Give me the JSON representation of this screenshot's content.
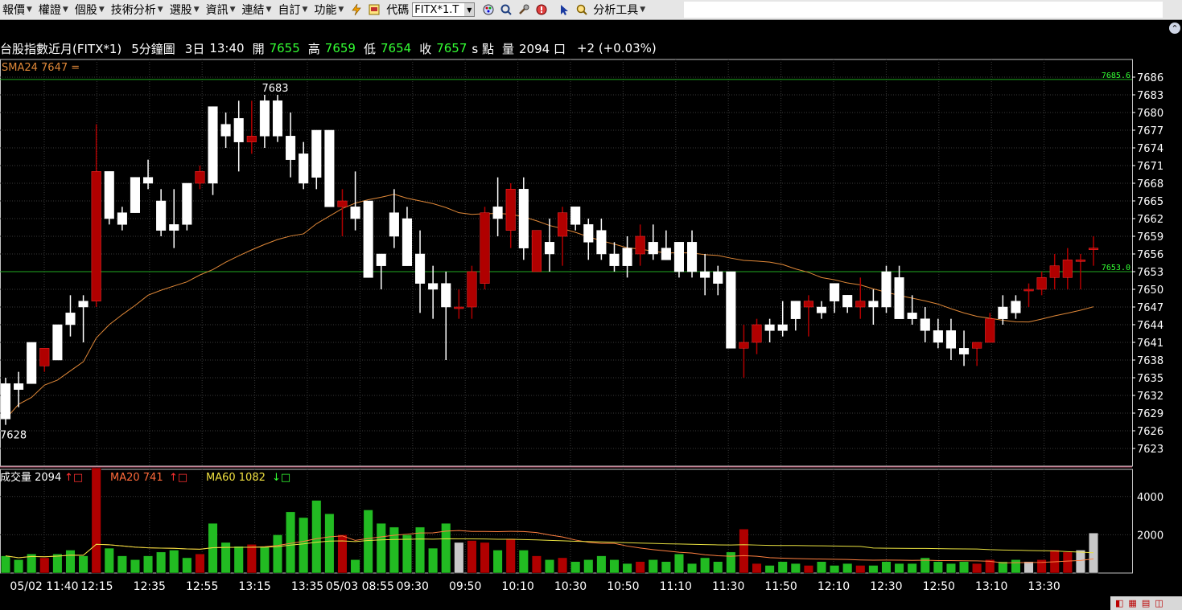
{
  "menu": {
    "items": [
      {
        "label": "報價",
        "name": "menu-quote"
      },
      {
        "label": "權證",
        "name": "menu-warrant"
      },
      {
        "label": "個股",
        "name": "menu-stock"
      },
      {
        "label": "技術分析",
        "name": "menu-technical"
      },
      {
        "label": "選股",
        "name": "menu-screener"
      },
      {
        "label": "資訊",
        "name": "menu-info"
      },
      {
        "label": "連結",
        "name": "menu-links"
      },
      {
        "label": "自訂",
        "name": "menu-custom"
      },
      {
        "label": "功能",
        "name": "menu-functions"
      }
    ],
    "code_label": "代碼",
    "code_value": "FITX*1.T",
    "tools_label": "分析工具"
  },
  "info": {
    "name": "台股指數近月(FITX*1)",
    "period": "5分鐘圖",
    "date": "3日",
    "time": "13:40",
    "open_label": "開",
    "open": "7655",
    "high_label": "高",
    "high": "7659",
    "low_label": "低",
    "low": "7654",
    "close_label": "收",
    "close": "7657",
    "unit": "s 點",
    "volume_label": "量",
    "volume": "2094 口",
    "change": "+2 (+0.03%)"
  },
  "indicators": {
    "sma_label": "SMA24 7647 =",
    "vol_label": "成交量 2094",
    "vol_ma20": "MA20 741",
    "vol_ma60": "MA60 1082"
  },
  "chart_data": {
    "type": "candlestick",
    "price_axis": {
      "min": 7620,
      "max": 7689,
      "ticks": [
        7686,
        7683,
        7680,
        7677,
        7674,
        7671,
        7668,
        7665,
        7662,
        7659,
        7656,
        7653,
        7650,
        7647,
        7644,
        7641,
        7638,
        7635,
        7632,
        7629,
        7626,
        7623
      ]
    },
    "volume_axis": {
      "max": 5000,
      "ticks": [
        4000,
        2000
      ]
    },
    "time_labels": [
      "05/02 11:40",
      "12:15",
      "12:35",
      "12:55",
      "13:15",
      "13:35",
      "05/03 08:55",
      "09:30",
      "09:50",
      "10:10",
      "10:30",
      "10:50",
      "11:10",
      "11:30",
      "11:50",
      "12:10",
      "12:30",
      "12:50",
      "13:10",
      "13:30"
    ],
    "annotations": {
      "high_label": "7683",
      "low_label": "7628",
      "right_top": "7685.6",
      "right_mid": "7653.0"
    },
    "hlines": [
      7685.6,
      7653.0
    ],
    "candles": [
      [
        7634,
        7635,
        7627,
        7628,
        900
      ],
      [
        7634,
        7636,
        7630,
        7633,
        700
      ],
      [
        7641,
        7641,
        7634,
        7634,
        1000
      ],
      [
        7637,
        7640,
        7636,
        7640,
        800
      ],
      [
        7644,
        7644,
        7638,
        7638,
        1000
      ],
      [
        7646,
        7649,
        7642,
        7644,
        1200
      ],
      [
        7648,
        7649,
        7641,
        7647,
        900
      ],
      [
        7648,
        7678,
        7647,
        7670,
        5500
      ],
      [
        7670,
        7670,
        7661,
        7662,
        1300
      ],
      [
        7663,
        7664,
        7660,
        7661,
        900
      ],
      [
        7669,
        7669,
        7663,
        7663,
        700
      ],
      [
        7669,
        7672,
        7667,
        7668,
        900
      ],
      [
        7665,
        7667,
        7659,
        7660,
        1100
      ],
      [
        7661,
        7667,
        7657,
        7660,
        1200
      ],
      [
        7668,
        7668,
        7660,
        7661,
        800
      ],
      [
        7668,
        7671,
        7667,
        7670,
        1000
      ],
      [
        7681,
        7681,
        7666,
        7668,
        2600
      ],
      [
        7678,
        7680,
        7674,
        7676,
        1600
      ],
      [
        7679,
        7682,
        7670,
        7675,
        1400
      ],
      [
        7675,
        7682,
        7673,
        7676,
        1500
      ],
      [
        7682,
        7683,
        7674,
        7676,
        1400
      ],
      [
        7682,
        7683,
        7675,
        7676,
        2000
      ],
      [
        7676,
        7680,
        7669,
        7672,
        3200
      ],
      [
        7673,
        7675,
        7667,
        7668,
        2900
      ],
      [
        7677,
        7677,
        7667,
        7669,
        3800
      ],
      [
        7677,
        7677,
        7664,
        7664,
        3100
      ],
      [
        7664,
        7667,
        7659,
        7665,
        2000
      ],
      [
        7664,
        7670,
        7660,
        7662,
        700
      ],
      [
        7665,
        7664,
        7652,
        7652,
        3300
      ],
      [
        7656,
        7656,
        7650,
        7654,
        2600
      ],
      [
        7663,
        7667,
        7657,
        7659,
        2400
      ],
      [
        7662,
        7664,
        7654,
        7654,
        2000
      ],
      [
        7656,
        7660,
        7646,
        7651,
        2400
      ],
      [
        7651,
        7654,
        7645,
        7650,
        1300
      ],
      [
        7651,
        7653,
        7638,
        7647,
        2600
      ],
      [
        7647,
        7650,
        7645,
        7647,
        1600
      ],
      [
        7647,
        7654,
        7645,
        7653,
        1700
      ],
      [
        7651,
        7664,
        7650,
        7663,
        1600
      ],
      [
        7664,
        7669,
        7659,
        7662,
        1200
      ],
      [
        7660,
        7668,
        7657,
        7667,
        1800
      ],
      [
        7667,
        7669,
        7655,
        7657,
        1200
      ],
      [
        7653,
        7660,
        7654,
        7660,
        900
      ],
      [
        7658,
        7662,
        7653,
        7656,
        700
      ],
      [
        7659,
        7664,
        7654,
        7663,
        800
      ],
      [
        7664,
        7663,
        7660,
        7661,
        600
      ],
      [
        7661,
        7662,
        7655,
        7658,
        700
      ],
      [
        7660,
        7662,
        7655,
        7656,
        900
      ],
      [
        7656,
        7658,
        7653,
        7654,
        700
      ],
      [
        7657,
        7659,
        7652,
        7654,
        500
      ],
      [
        7656,
        7661,
        7654,
        7659,
        600
      ],
      [
        7658,
        7661,
        7655,
        7656,
        700
      ],
      [
        7657,
        7660,
        7655,
        7655,
        600
      ],
      [
        7658,
        7658,
        7652,
        7653,
        1000
      ],
      [
        7658,
        7660,
        7652,
        7653,
        500
      ],
      [
        7653,
        7656,
        7649,
        7652,
        800
      ],
      [
        7653,
        7654,
        7649,
        7651,
        600
      ],
      [
        7653,
        7653,
        7640,
        7640,
        1100
      ],
      [
        7640,
        7644,
        7635,
        7641,
        2300
      ],
      [
        7641,
        7645,
        7639,
        7644,
        500
      ],
      [
        7644,
        7645,
        7641,
        7643,
        400
      ],
      [
        7644,
        7648,
        7642,
        7643,
        600
      ],
      [
        7648,
        7648,
        7643,
        7645,
        500
      ],
      [
        7647,
        7649,
        7642,
        7648,
        400
      ],
      [
        7647,
        7648,
        7645,
        7646,
        600
      ],
      [
        7651,
        7651,
        7646,
        7648,
        400
      ],
      [
        7649,
        7649,
        7646,
        7647,
        500
      ],
      [
        7647,
        7652,
        7645,
        7648,
        400
      ],
      [
        7648,
        7650,
        7644,
        7647,
        400
      ],
      [
        7653,
        7654,
        7646,
        7647,
        600
      ],
      [
        7652,
        7654,
        7645,
        7645,
        500
      ],
      [
        7646,
        7649,
        7644,
        7645,
        500
      ],
      [
        7645,
        7647,
        7641,
        7643,
        800
      ],
      [
        7643,
        7645,
        7640,
        7641,
        600
      ],
      [
        7643,
        7645,
        7638,
        7640,
        500
      ],
      [
        7640,
        7643,
        7637,
        7639,
        600
      ],
      [
        7640,
        7641,
        7637,
        7641,
        500
      ],
      [
        7641,
        7646,
        7641,
        7645,
        700
      ],
      [
        7647,
        7649,
        7644,
        7645,
        600
      ],
      [
        7648,
        7649,
        7645,
        7646,
        700
      ],
      [
        7650,
        7651,
        7647,
        7650,
        600
      ],
      [
        7650,
        7653,
        7649,
        7652,
        700
      ],
      [
        7652,
        7656,
        7650,
        7654,
        1200
      ],
      [
        7652,
        7657,
        7650,
        7655,
        1100
      ],
      [
        7655,
        7656,
        7650,
        7655,
        1200
      ],
      [
        7657,
        7659,
        7654,
        7657,
        2094
      ]
    ]
  },
  "colors": {
    "up": "#b00000",
    "down": "#ffffff",
    "vol_up": "#b00000",
    "vol_down": "#22bb22",
    "sma": "#e08838",
    "grid": "#3a3a3a",
    "axis": "#ffffff"
  }
}
